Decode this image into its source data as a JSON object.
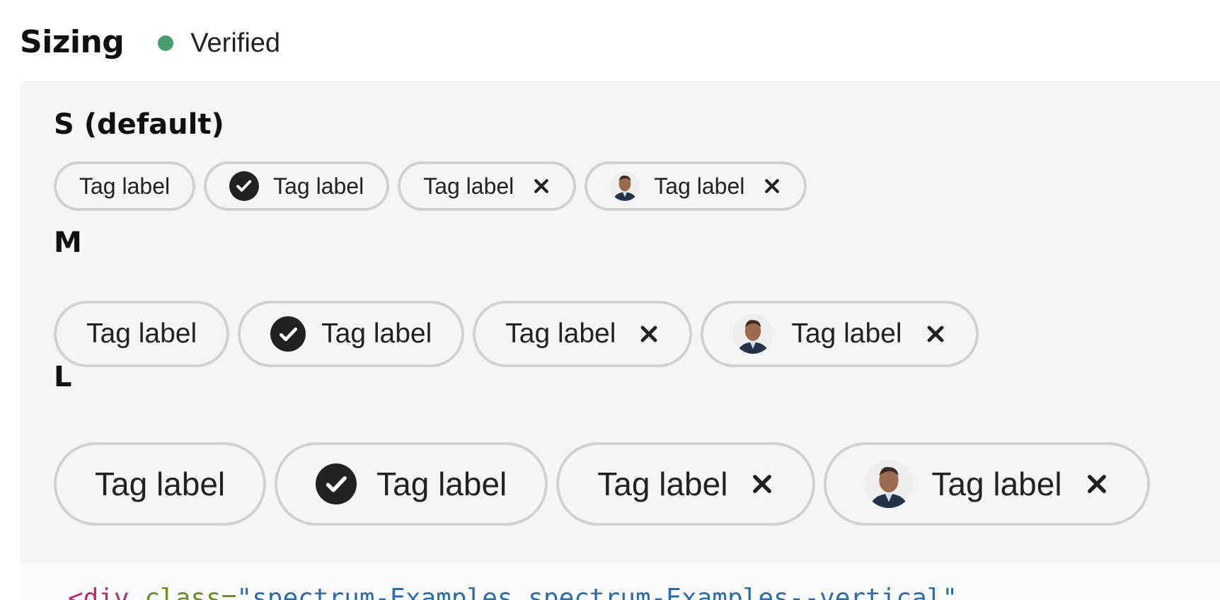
{
  "header": {
    "title": "Sizing",
    "status": "Verified",
    "status_color": "#4a9d6f"
  },
  "sizes": {
    "s": {
      "heading": "S (default)",
      "tags": {
        "plain": "Tag label",
        "check": "Tag label",
        "removable": "Tag label",
        "avatar": "Tag label"
      }
    },
    "m": {
      "heading": "M",
      "tags": {
        "plain": "Tag label",
        "check": "Tag label",
        "removable": "Tag label",
        "avatar": "Tag label"
      }
    },
    "l": {
      "heading": "L",
      "tags": {
        "plain": "Tag label",
        "check": "Tag label",
        "removable": "Tag label",
        "avatar": "Tag label"
      }
    }
  },
  "code": {
    "open": "<div",
    "attr": " class=",
    "value": "\"spectrum-Examples spectrum-Examples--vertical\""
  },
  "icons": {
    "check": "checkmark-circle-icon",
    "remove": "cross-icon",
    "avatar": "person-photo-avatar"
  },
  "colors": {
    "tag_border": "#d1d1d1",
    "panel_bg": "#f5f5f5",
    "text": "#222222"
  }
}
